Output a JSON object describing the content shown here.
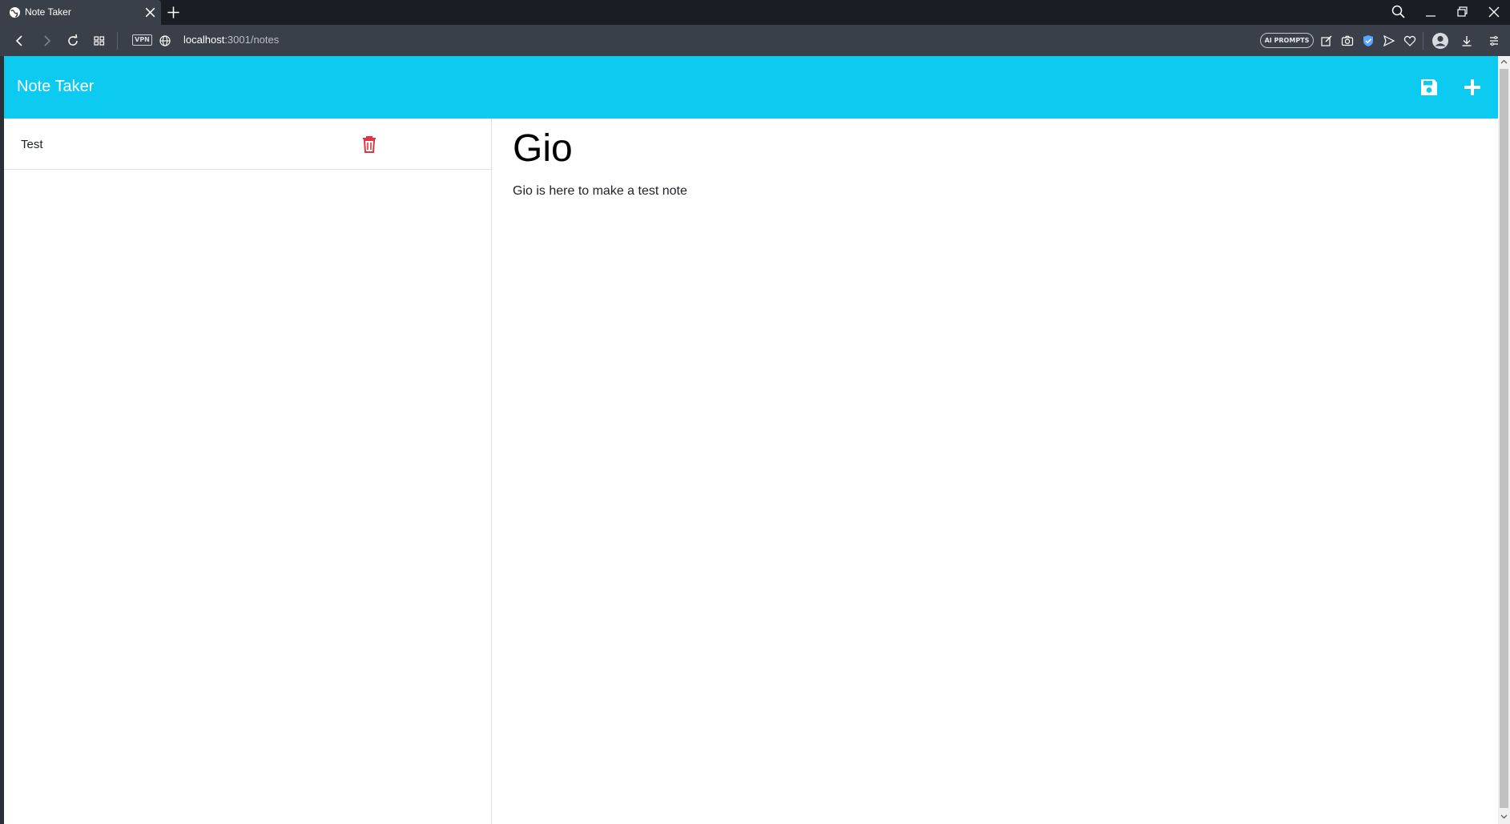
{
  "browser": {
    "tab_title": "Note Taker",
    "url_host": "localhost",
    "url_path": ":3001/notes",
    "vpn_label": "VPN",
    "ai_prompts_label": "AI PROMPTS"
  },
  "app": {
    "brand": "Note Taker",
    "accent_color": "#0dcaf0",
    "delete_color": "#dc3545"
  },
  "sidebar": {
    "notes": [
      {
        "title": "Test"
      }
    ]
  },
  "editor": {
    "title": "Gio",
    "text": "Gio is here to make a test note"
  }
}
